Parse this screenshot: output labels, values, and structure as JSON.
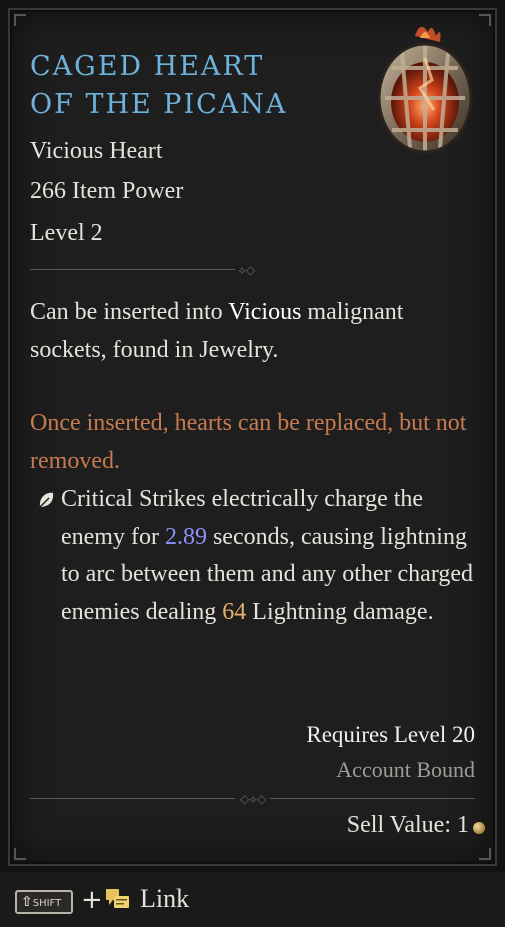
{
  "item": {
    "name_line1": "CAGED HEART",
    "name_line2": "OF THE PICANA",
    "type": "Vicious Heart",
    "item_power": "266 Item Power",
    "level": "Level 2",
    "icon": "caged-heart-icon"
  },
  "description": {
    "insert_prefix": "Can be inserted into ",
    "socket_type": "Vicious",
    "insert_suffix": " malignant sockets, found in Jewelry.",
    "warning": "Once inserted, hearts can be replaced, but not removed."
  },
  "affix": {
    "icon": "malignant-affix-icon",
    "part1": "Critical Strikes electrically charge the enemy for ",
    "duration": "2.89",
    "part2": " seconds, causing lightning to arc between them and any other charged enemies dealing ",
    "damage": "64",
    "part3": " Lightning damage."
  },
  "requirements": {
    "level": "Requires Level 20",
    "binding": "Account Bound"
  },
  "sell": {
    "label": "Sell Value: 1",
    "icon": "gold-coin-icon"
  },
  "footer": {
    "shift_key": "SHIFT",
    "plus": "+",
    "chat_icon": "chat-icon",
    "link_label": "Link"
  },
  "colors": {
    "title": "#6fb3dd",
    "warning": "#c77a4f",
    "value_blue": "#8c92f5",
    "value_gold": "#e6b26a"
  }
}
